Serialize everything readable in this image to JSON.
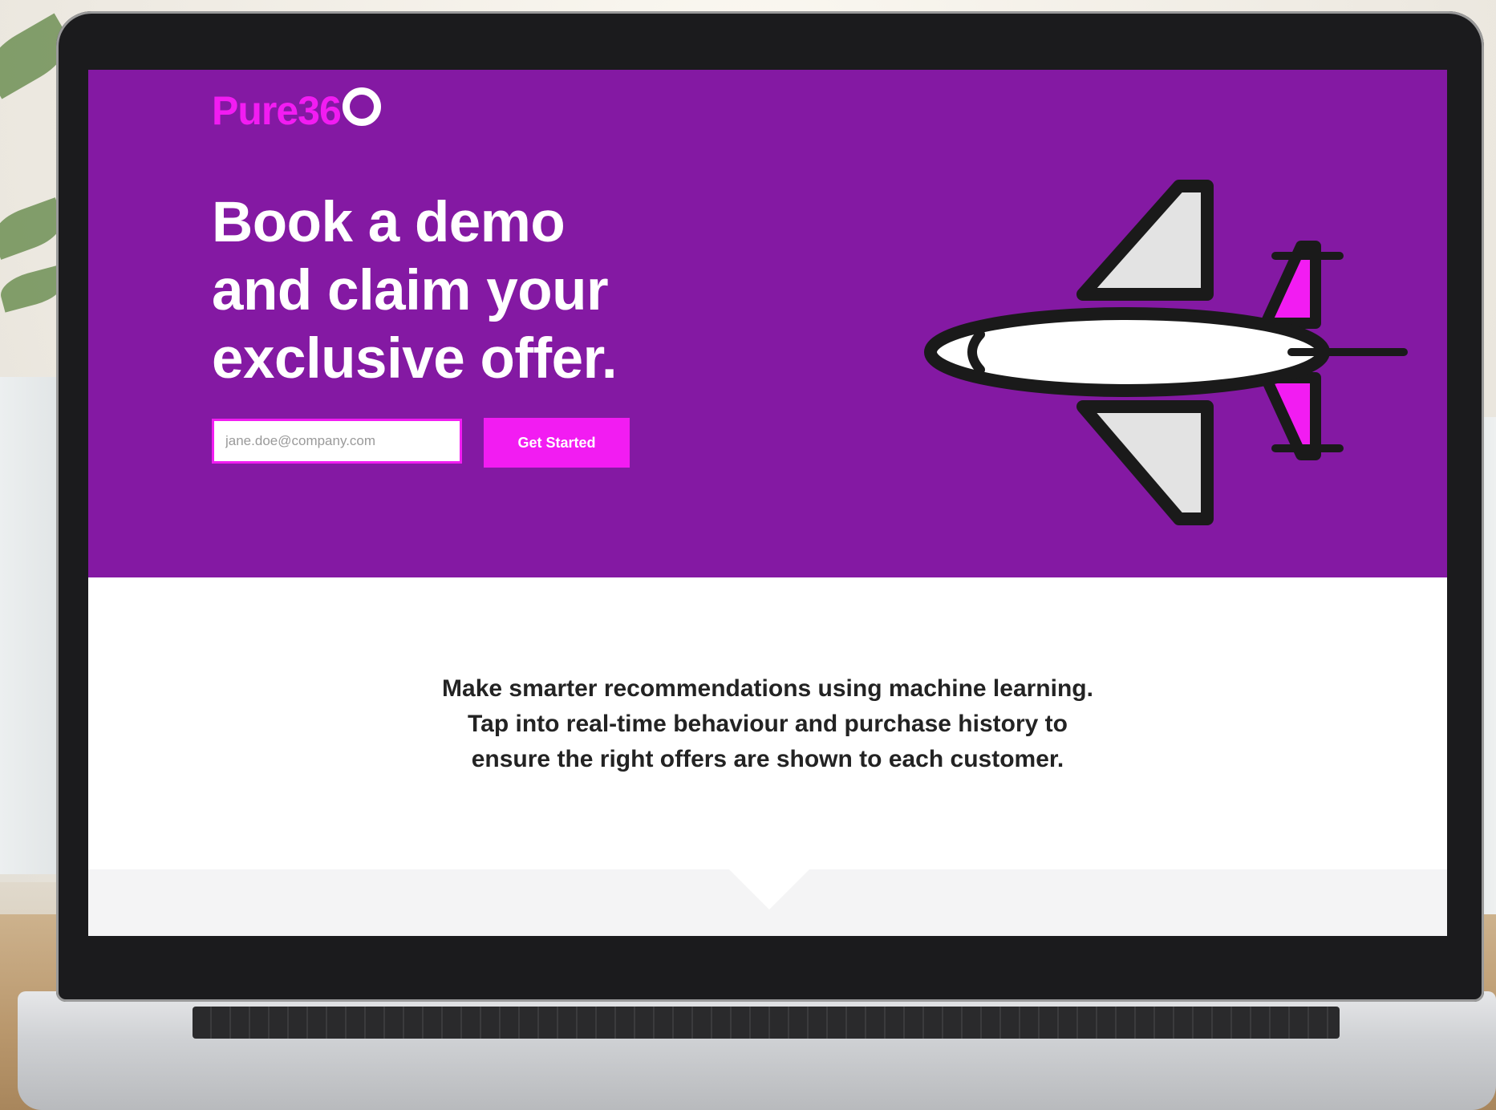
{
  "brand": {
    "logo_text": "Pure36",
    "accent_color": "#f21cf2",
    "hero_color": "#8419a3"
  },
  "hero": {
    "headline_line1": "Book a demo",
    "headline_line2": "and claim your",
    "headline_line3": "exclusive offer.",
    "email_placeholder": "jane.doe@company.com",
    "cta_label": "Get Started",
    "illustration_icon": "airplane-icon"
  },
  "content": {
    "line1": "Make smarter recommendations using machine learning.",
    "line2": "Tap into real-time behaviour and purchase history to",
    "line3": "ensure the right offers are shown to each customer."
  }
}
